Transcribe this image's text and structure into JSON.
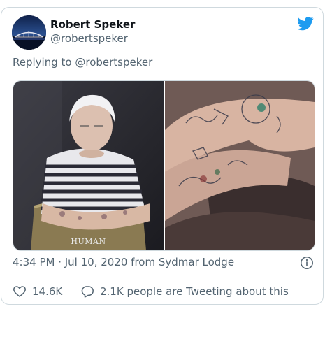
{
  "tweet": {
    "author_name": "Robert Speker",
    "author_handle": "@robertspeker",
    "reply_prefix": "Replying to",
    "reply_to": "@robertspeker",
    "watermark": "HUMAN",
    "timestamp": "4:34 PM · Jul 10, 2020 from Sydmar Lodge",
    "likes": "14.6K",
    "conversation": "2.1K people are Tweeting about this"
  },
  "icons": {
    "brand": "twitter-bird-icon",
    "info": "info-icon",
    "like": "heart-icon",
    "reply": "speech-bubble-icon"
  },
  "colors": {
    "brand_blue": "#1d9bf0",
    "secondary_text": "#536471",
    "border": "#cfd9de"
  }
}
